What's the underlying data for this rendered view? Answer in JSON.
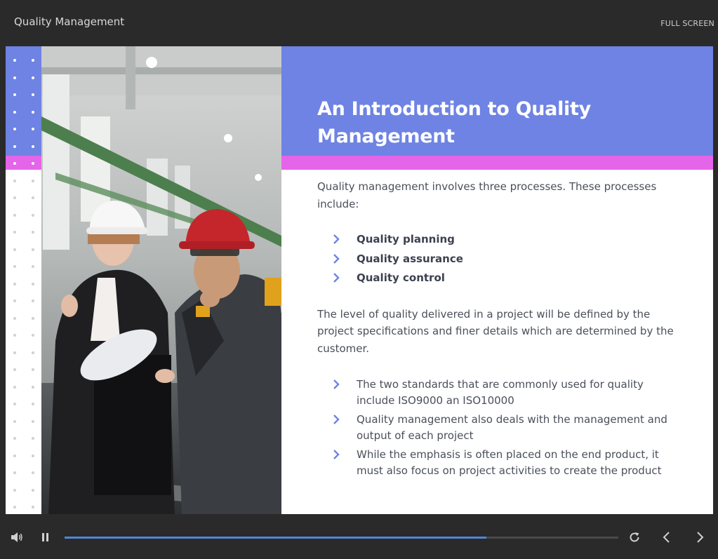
{
  "app": {
    "title": "Quality Management",
    "fullscreen_label": "FULL SCREEN"
  },
  "slide": {
    "title": "An Introduction to Quality Management",
    "intro": "Quality management involves three processes. These processes include:",
    "processes": [
      "Quality planning",
      "Quality assurance",
      "Quality control"
    ],
    "paragraph": "The level of quality delivered in a project will be defined by the project specifications and finer details which are determined by the customer.",
    "points": [
      "The two standards that are commonly used for quality include ISO9000 an ISO10000",
      "Quality management also deals with the management and output of each project",
      "While the emphasis is often placed on the end product, it must also focus on project activities to create the product"
    ],
    "photo_alt": "Two engineers in hard hats in a factory"
  },
  "player": {
    "progress": 0.762,
    "icons": {
      "volume": "volume-icon",
      "pause": "pause-icon",
      "replay": "replay-icon",
      "prev": "chevron-left-icon",
      "next": "chevron-right-icon",
      "bullet": "chevron-right-icon"
    }
  },
  "colors": {
    "accent_blue": "#6e83e3",
    "accent_pink": "#e464ea",
    "text": "#4a4f5a",
    "progress": "#4f86d8",
    "bar": "#2a2a2a"
  }
}
